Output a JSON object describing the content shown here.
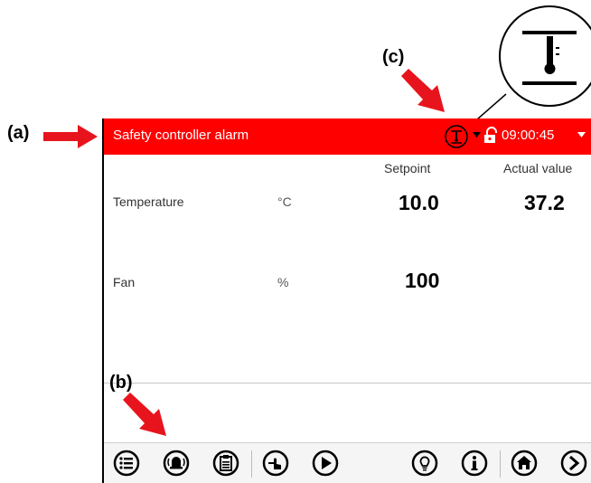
{
  "callouts": {
    "a": "(a)",
    "b": "(b)",
    "c": "(c)"
  },
  "status_bar": {
    "alarm_text": "Safety controller alarm",
    "time": "09:00:45",
    "color": "#ff0000"
  },
  "table": {
    "headers": {
      "setpoint": "Setpoint",
      "actual": "Actual value"
    },
    "rows": [
      {
        "label": "Temperature",
        "unit": "°C",
        "setpoint": "10.0",
        "actual": "37.2"
      },
      {
        "label": "Fan",
        "unit": "%",
        "setpoint": "100",
        "actual": ""
      }
    ]
  },
  "toolbar": {
    "icons": [
      "menu-list-icon",
      "alarm-bell-icon",
      "clipboard-icon",
      "manual-touch-icon",
      "play-icon",
      "light-bulb-icon",
      "info-icon",
      "home-icon",
      "next-icon"
    ]
  }
}
